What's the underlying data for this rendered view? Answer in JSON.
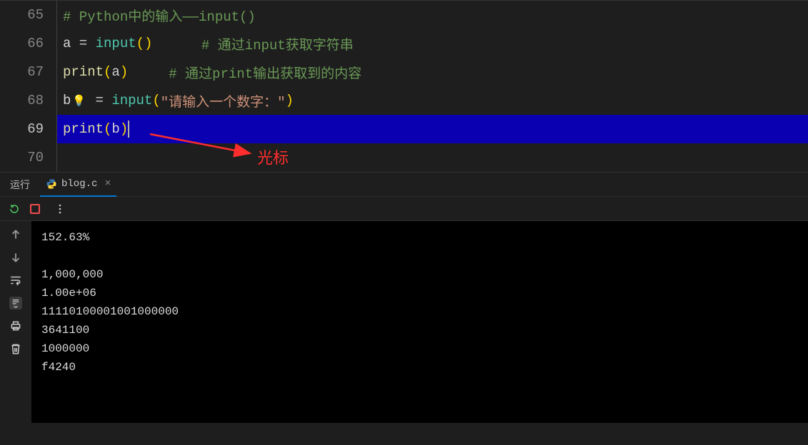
{
  "editor": {
    "lines": [
      {
        "n": "65"
      },
      {
        "n": "66"
      },
      {
        "n": "67"
      },
      {
        "n": "68"
      },
      {
        "n": "69"
      },
      {
        "n": "70"
      }
    ],
    "l65_comment": "# Python中的输入——input()",
    "l66_a": "a",
    "l66_eq": " = ",
    "l66_input": "input",
    "l66_paren": "()",
    "l66_space": "      ",
    "l66_comment": "# 通过input获取字符串",
    "l67_print": "print",
    "l67_open": "(",
    "l67_a": "a",
    "l67_close": ")",
    "l67_space": "     ",
    "l67_comment": "# 通过print输出获取到的内容",
    "l68_b": "b",
    "l68_eq": " = ",
    "l68_input": "input",
    "l68_open": "(",
    "l68_str": "\"请输入一个数字：\"",
    "l68_close": ")",
    "l69_print": "print",
    "l69_open": "(",
    "l69_b": "b",
    "l69_close": ")"
  },
  "annotation": {
    "label": "光标"
  },
  "panel": {
    "run_label": "运行",
    "file_name": "blog.c",
    "output_lines": [
      "152.63%",
      "",
      "1,000,000",
      "1.00e+06",
      "11110100001001000000",
      "3641100",
      "1000000",
      "f4240"
    ]
  }
}
